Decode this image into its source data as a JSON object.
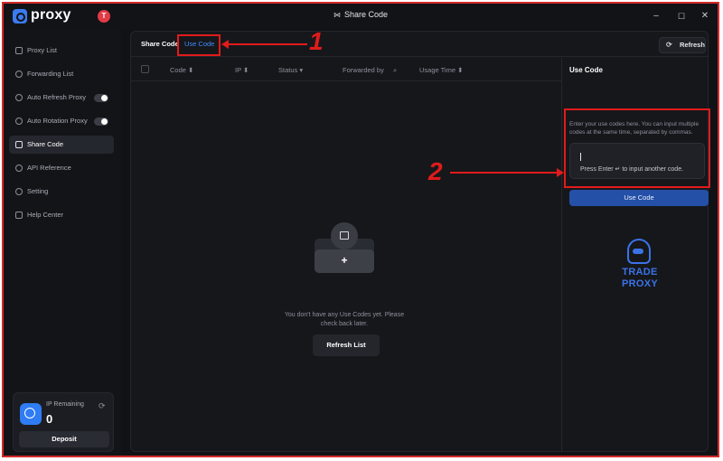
{
  "app": {
    "brand": "proxy",
    "avatar_initial": "T",
    "window_title": "Share Code"
  },
  "window_controls": {
    "minimize": "–",
    "maximize": "☐",
    "close": "✕"
  },
  "sidebar": {
    "items": [
      {
        "label": "Proxy List",
        "icon": "server-icon"
      },
      {
        "label": "Forwarding List",
        "icon": "link-icon"
      },
      {
        "label": "Auto Refresh Proxy",
        "icon": "globe-refresh-icon",
        "toggle": true
      },
      {
        "label": "Auto Rotation Proxy",
        "icon": "rotate-icon",
        "toggle": true
      },
      {
        "label": "Share Code",
        "icon": "share-icon",
        "active": true
      },
      {
        "label": "API Reference",
        "icon": "api-icon"
      },
      {
        "label": "Setting",
        "icon": "gear-icon"
      },
      {
        "label": "Help Center",
        "icon": "chat-icon"
      }
    ],
    "ip_card": {
      "label": "IP Remaining",
      "value": "0",
      "deposit_label": "Deposit"
    }
  },
  "main": {
    "tabs": [
      {
        "label": "Share Code"
      },
      {
        "label": "Use Code",
        "active": true
      }
    ],
    "refresh_label": "Refresh",
    "columns": [
      "Code ⬍",
      "IP ⬍",
      "Status ▾",
      "Forwarded by",
      "Usage Time ⬍"
    ],
    "empty_message": "You don't have any Use Codes yet. Please check back later.",
    "refresh_list_label": "Refresh List"
  },
  "panel": {
    "title": "Use Code",
    "description": "Enter your use codes here. You can input multiple codes at the same time, separated by commas.",
    "input_placeholder": "Press Enter ↵ to input another code.",
    "use_button_label": "Use Code",
    "logo_line1": "TRADE",
    "logo_line2": "PROXY"
  },
  "annotations": {
    "num1": "1",
    "num2": "2"
  },
  "colors": {
    "accent": "#3f8cff",
    "annotation": "#e01b1b",
    "background": "#111216",
    "button_blue": "#2450a8"
  }
}
